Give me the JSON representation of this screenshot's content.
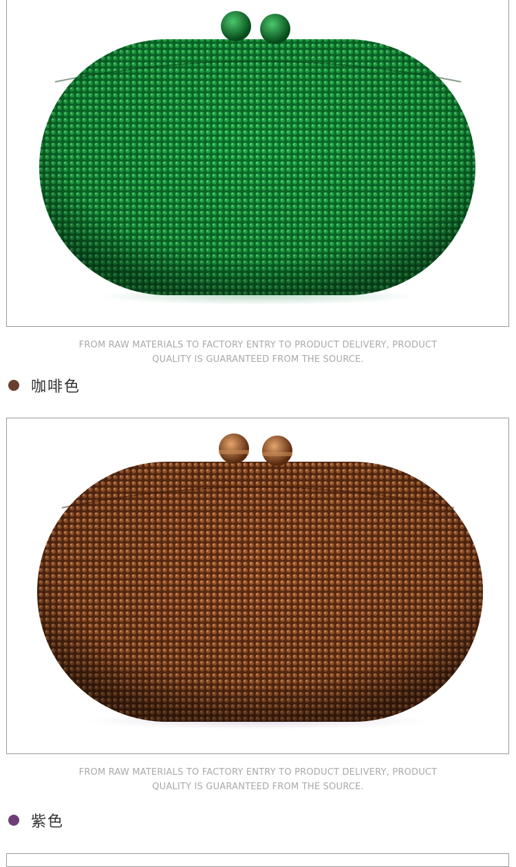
{
  "colors": {
    "coffee_dot": "#6b3f2e",
    "purple_dot": "#6e3d78",
    "caption_text": "#a9a9a9",
    "frame_border": "#9a9a9a"
  },
  "products": [
    {
      "image_alt": "green crystal oval clutch",
      "caption_line1": "FROM RAW MATERIALS TO FACTORY ENTRY TO PRODUCT DELIVERY, PRODUCT",
      "caption_line2": "QUALITY IS GUARANTEED FROM THE SOURCE.",
      "next_color_label": "咖啡色"
    },
    {
      "image_alt": "coffee crystal oval clutch",
      "caption_line1": "FROM RAW MATERIALS TO FACTORY ENTRY TO PRODUCT DELIVERY, PRODUCT",
      "caption_line2": "QUALITY IS GUARANTEED FROM THE SOURCE.",
      "next_color_label": "紫色"
    }
  ]
}
